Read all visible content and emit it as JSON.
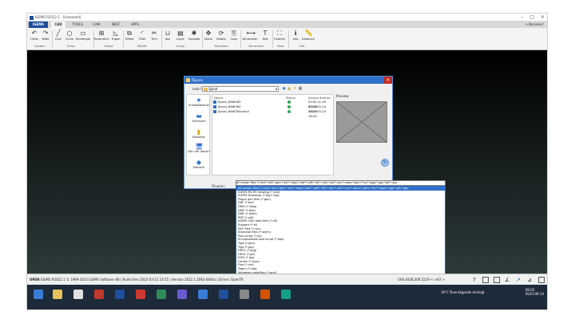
{
  "app": {
    "title": "IGEMS R2022.1 - [Unnamed]",
    "brand": "IGEMS"
  },
  "tabs": [
    "CAD",
    "TOOLS",
    "CAM",
    "NEST",
    "APPS"
  ],
  "user": "Noname?",
  "ribbon": {
    "tools": [
      "Undo",
      "Redo",
      "Line",
      "Circle",
      "Rectangle",
      "Parametric",
      "Trigon",
      "Offset",
      "Fillet",
      "Trim",
      "Join",
      "Layer",
      "Explode",
      "Move",
      "Rotate",
      "Copy",
      "Dimension",
      "Text",
      "Info",
      "Distance"
    ],
    "groups": [
      "System",
      "Draw",
      "Shape",
      "Modify",
      "Group",
      "Transform",
      "Dimension",
      "View",
      "Info"
    ]
  },
  "dialog": {
    "title": "Öppna",
    "lookin_label": "Leta i:",
    "lookin_value": "Spiral",
    "places": [
      "Snabbåtkomst",
      "Skrivbord",
      "Bibliotek",
      "Den här datorn",
      "Nätverk"
    ],
    "columns": [
      "Namn",
      "Status",
      "Senast ändrad",
      "Preview"
    ],
    "files": [
      {
        "name": "Spiral_RAW300",
        "date": "2016-11-25 09:06"
      },
      {
        "name": "Spiral_RAW300",
        "date": "2023-05-24 16:02"
      },
      {
        "name": "Spiral_RAW300small",
        "date": "2023-05-24 16:02"
      }
    ],
    "filename_label": "Filnamn:",
    "filename_value": "",
    "filetype_label": "Filformat:",
    "filetype_value": "All known files (*.ecd;*.dxf;*.gen;*.dxf;*.dwg;*.dwf;*.pdf;*.xfl;*.clip;*.xst;*.nsc;*.mpm;*.gen;*.hp;*.hpgl;*.jpg;*.gif;*.igs)",
    "open_button": "Öppna",
    "cancel_button": "Avbryt"
  },
  "filter_options": [
    "All known files (*.ecd;*.dxf;*.gen;*.dxf;*.dwg;*.dwf;*.pdf;*.xfl;*.clip;*.xst;*.nsc;*.mpm;*.gen;*.hp;*.hpgl;*.jpg;*.gif;*.igs)",
    "IGEMS R5-R9 drawing (*.ecd)",
    "IGEMS Drawings (*.dig;*.dig)",
    "Trigon gen files (*.gen)",
    "DXF (*.dxf)",
    "DWG (*.dwg)",
    "DWF (*.dwf)",
    "DWF (*.dwfx)",
    "PDF (*.pdf)",
    "IGEMS CNC data files (*.xfl)",
    "Support (*.el)",
    "NCF files (*.nsc)",
    "Stomatai files (*.skym)",
    "Post script (*.ps)",
    "Encapsulated post script (*.eps)",
    "Tiga (*.gen)",
    "Tiga (*.jpg)",
    "HPGL (*.hpg)",
    "HPGL (*.plt)",
    "IGES (*.igs)",
    "Lantek (*.mwc)",
    "Fine (*.cnf)",
    "Tagiru (*.tag)",
    "Windows metafiles (*.wmf)",
    "Any file (*.*)"
  ],
  "status": {
    "mode": "OPEN",
    "info": "IGEMS R2022.1 © 1999-2023 IGEMS Software AB | Build time 2022-03-21 14:55 | Version 2022.1.2063 64bits | Driver: OpenTK",
    "coords": "-160.4438,309.5219 <->87.>"
  },
  "taskbar": {
    "weather": "10°C  Övervägande molnigt",
    "time": "09:03",
    "date": "2023-06-14"
  }
}
